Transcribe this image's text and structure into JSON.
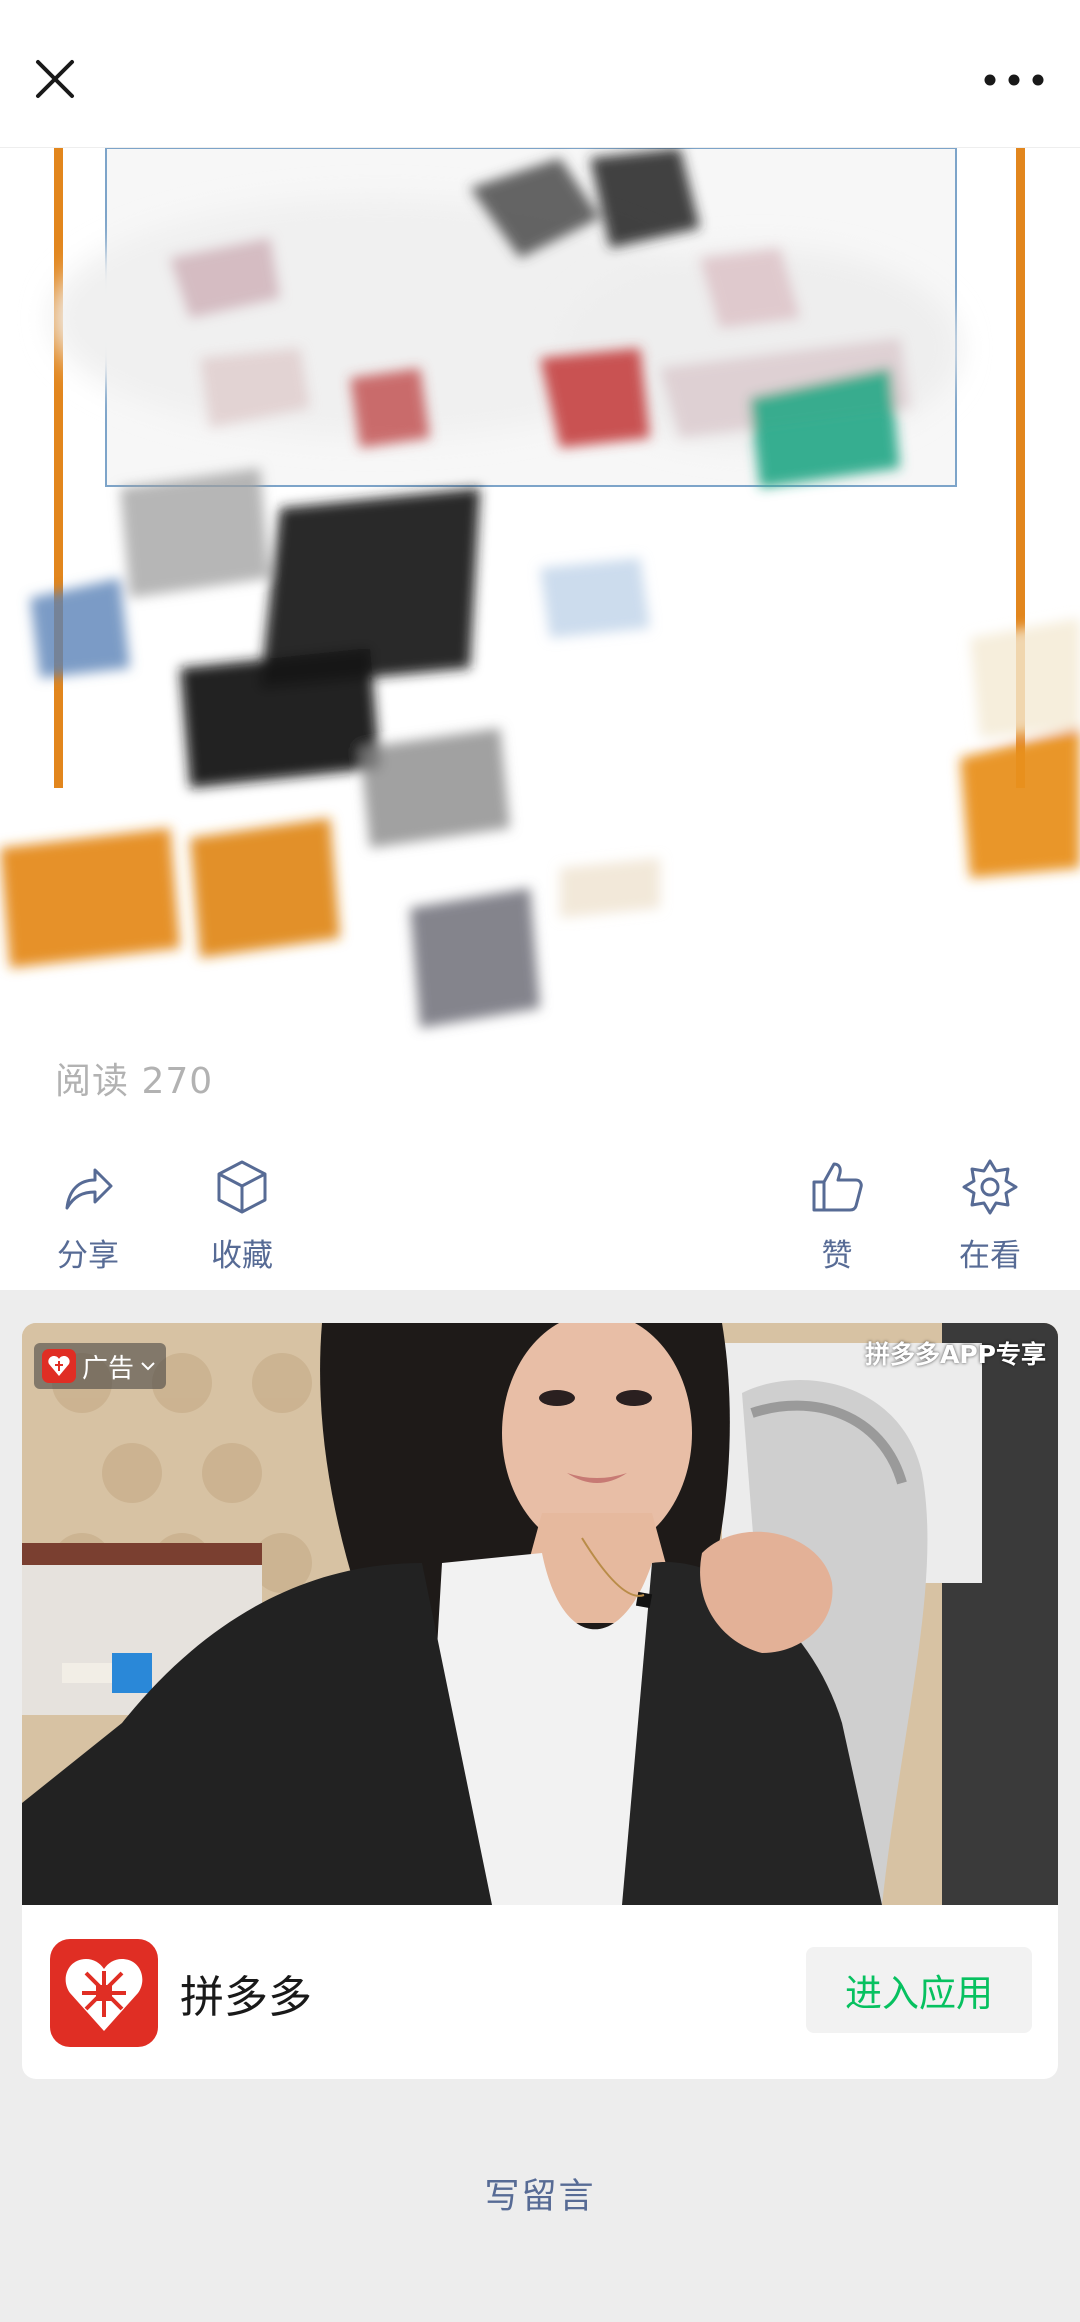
{
  "article": {
    "read_label": "阅读 270"
  },
  "actions": {
    "share": "分享",
    "favorite": "收藏",
    "like": "赞",
    "wow": "在看"
  },
  "ad": {
    "badge": "广告",
    "tag": "拼多多APP专享",
    "app_name": "拼多多",
    "button": "进入应用",
    "brand_color": "#e02e24",
    "button_color": "#07c160"
  },
  "footer": {
    "write_comment": "写留言"
  },
  "icons": [
    "close-icon",
    "more-icon",
    "share-icon",
    "favorite-icon",
    "like-icon",
    "wow-icon",
    "pinduoduo-logo",
    "chevron-down-icon"
  ]
}
